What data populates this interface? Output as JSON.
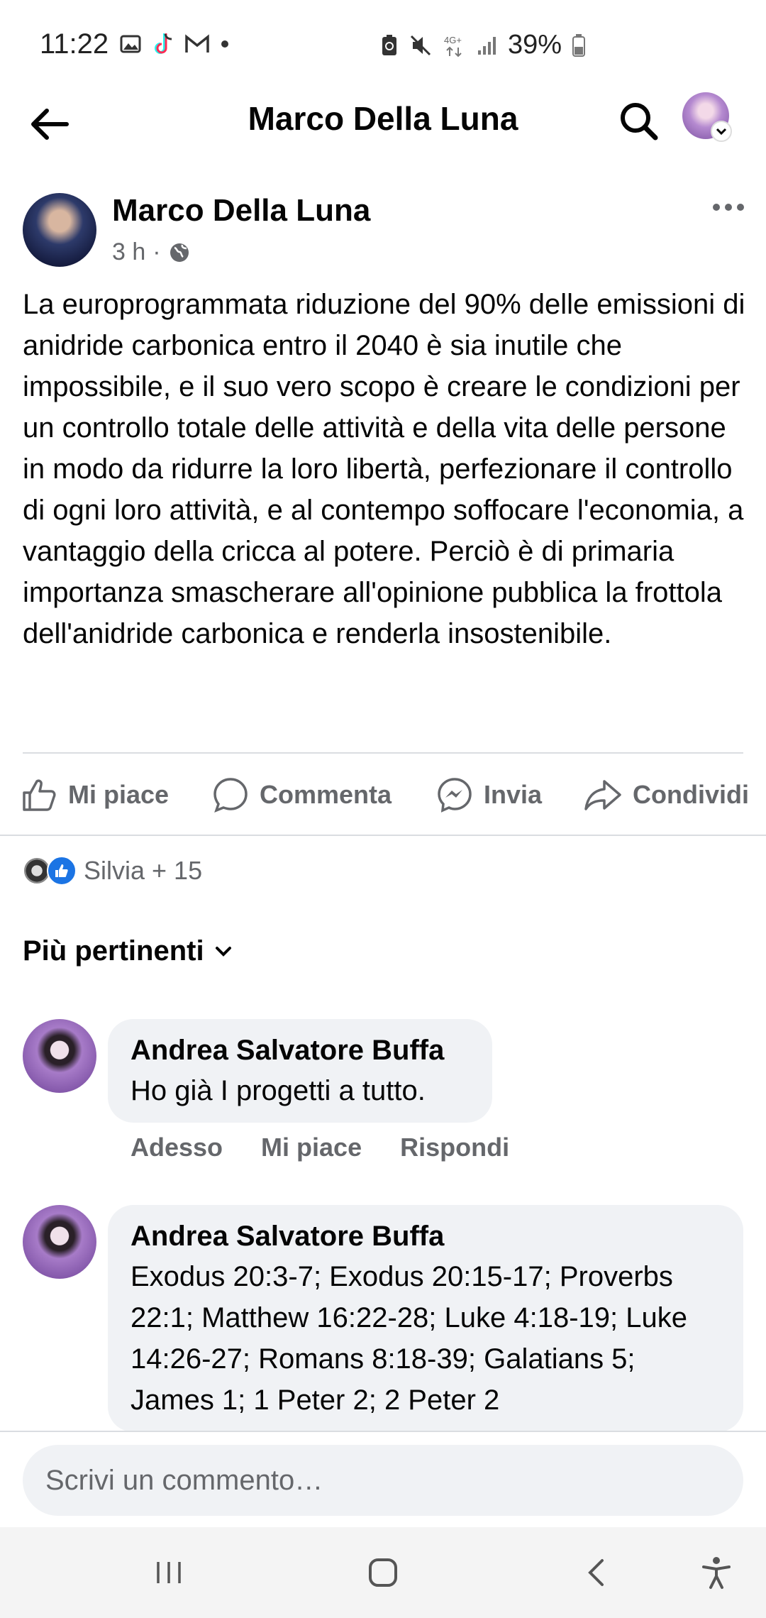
{
  "status_bar": {
    "time": "11:22",
    "battery": "39%",
    "network": "4G+"
  },
  "header": {
    "title": "Marco Della Luna"
  },
  "post": {
    "author": "Marco Della Luna",
    "time": "3 h",
    "meta_separator": "·",
    "text": "La europrogrammata riduzione del 90% delle emissioni di anidride carbonica entro il 2040 è sia inutile che impossibile, e il suo vero scopo è creare le condizioni per un controllo totale delle attività e della vita delle persone in modo da ridurre la loro libertà, perfezionare il controllo di ogni loro attività, e al contempo soffocare l'economia, a vantaggio della cricca al potere. Perciò è di primaria importanza smascherare all'opinione pubblica la frottola dell'anidride carbonica e renderla insostenibile."
  },
  "actions": {
    "like": "Mi piace",
    "comment": "Commenta",
    "send": "Invia",
    "share": "Condividi"
  },
  "reactions": {
    "summary": "Silvia + 15"
  },
  "sort": {
    "label": "Più pertinenti"
  },
  "comments": [
    {
      "author": "Andrea Salvatore Buffa",
      "text": "Ho già I progetti a tutto.",
      "time": "Adesso",
      "like": "Mi piace",
      "reply": "Rispondi"
    },
    {
      "author": "Andrea Salvatore Buffa",
      "text": "Exodus 20:3-7; Exodus 20:15-17; Proverbs 22:1; Matthew 16:22-28; Luke 4:18-19; Luke 14:26-27; Romans 8:18-39; Galatians 5; James 1; 1 Peter 2; 2 Peter 2"
    }
  ],
  "composer": {
    "placeholder": "Scrivi un commento…"
  },
  "colors": {
    "accent": "#1b74e4",
    "secondary_text": "#65676b",
    "bubble": "#f0f2f5"
  }
}
